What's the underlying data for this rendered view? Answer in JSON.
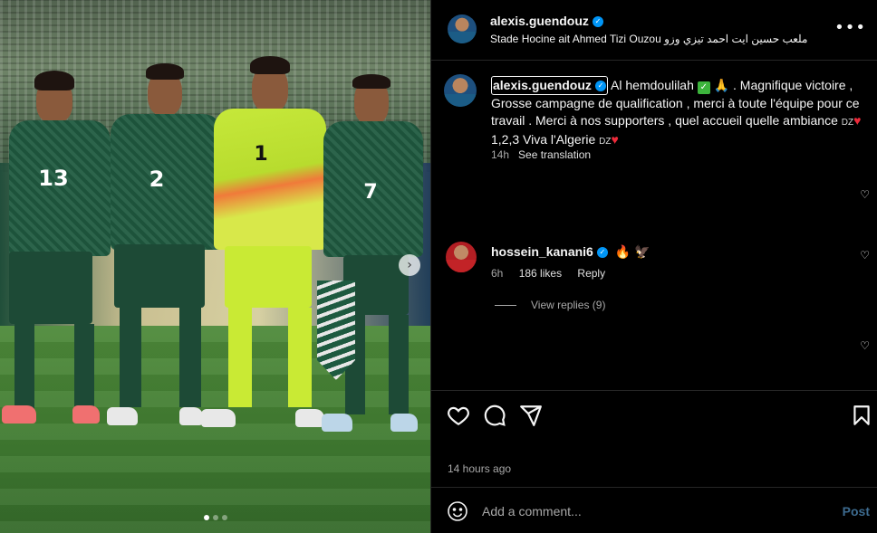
{
  "post": {
    "photo": {
      "current_index": 1,
      "total": 3
    }
  },
  "header": {
    "username": "alexis.guendouz",
    "location": "Stade Hocine ait Ahmed Tizi Ouzou ملعب حسين ايت احمد تيزي وزو",
    "more_label": "•••"
  },
  "caption": {
    "username": "alexis.guendouz",
    "part1": "Al hemdoulilah",
    "part2": ". Magnifique victoire , Grosse campagne de qualification , merci à toute l'équipe pour ce travail . Merci à nos supporters , quel accueil quelle ambiance",
    "flag": "DZ",
    "part3": "1,2,3 Viva l'Algerie",
    "time": "14h",
    "see_translation": "See translation"
  },
  "comments": [
    {
      "username": "hossein_kanani6",
      "text": "🔥 🦅",
      "time": "6h",
      "likes": "186 likes",
      "reply": "Reply",
      "view_replies": "View replies (9)"
    }
  ],
  "footer": {
    "timestamp": "14 hours ago",
    "comment_placeholder": "Add a comment...",
    "post_label": "Post"
  },
  "jersey_numbers": [
    "13",
    "2",
    "1",
    "7"
  ],
  "colors": {
    "verified": "#0095f6",
    "heart": "#ed2a3a",
    "post_disabled": "#3d6b8f"
  }
}
